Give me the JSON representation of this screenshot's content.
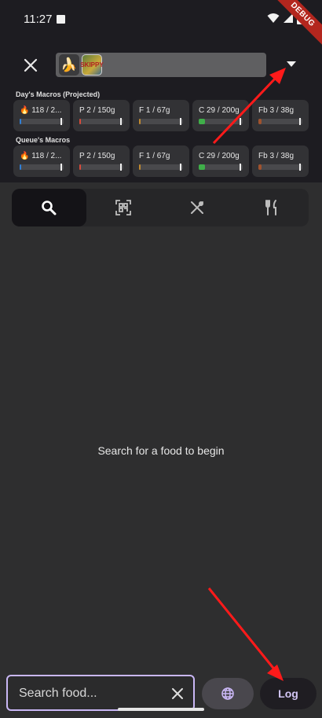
{
  "status_bar": {
    "time": "11:27",
    "debug_label": "DEBUG"
  },
  "queue": {
    "thumb_items": [
      "🍌",
      "SKIPPY"
    ]
  },
  "sections": {
    "day_label": "Day's Macros (Projected)",
    "queue_label": "Queue's Macros"
  },
  "day_macros": [
    {
      "label": "🔥 118 / 2...",
      "fill_fraction": 0.03,
      "color": "#2f7fd6"
    },
    {
      "label": "P 2 / 150g",
      "fill_fraction": 0.01,
      "color": "#d94a3a"
    },
    {
      "label": "F 1 / 67g",
      "fill_fraction": 0.01,
      "color": "#c08a30"
    },
    {
      "label": "C 29 / 200g",
      "fill_fraction": 0.14,
      "color": "#3fae49"
    },
    {
      "label": "Fb 3 / 38g",
      "fill_fraction": 0.08,
      "color": "#a0522d"
    }
  ],
  "queue_macros": [
    {
      "label": "🔥 118 / 2...",
      "fill_fraction": 0.03,
      "color": "#2f7fd6"
    },
    {
      "label": "P 2 / 150g",
      "fill_fraction": 0.01,
      "color": "#d94a3a"
    },
    {
      "label": "F 1 / 67g",
      "fill_fraction": 0.01,
      "color": "#c08a30"
    },
    {
      "label": "C 29 / 200g",
      "fill_fraction": 0.14,
      "color": "#3fae49"
    },
    {
      "label": "Fb 3 / 38g",
      "fill_fraction": 0.08,
      "color": "#a0522d"
    }
  ],
  "tabs": [
    {
      "icon": "search-icon",
      "active": true
    },
    {
      "icon": "qr-scan-icon",
      "active": false
    },
    {
      "icon": "cutlery-crossed-icon",
      "active": false
    },
    {
      "icon": "restaurant-icon",
      "active": false
    }
  ],
  "main": {
    "empty_message": "Search for a food to begin"
  },
  "bottom": {
    "search_placeholder": "Search food...",
    "log_label": "Log"
  },
  "colors": {
    "accent": "#c9b7f5",
    "annotation_arrow": "#ff1a1a"
  }
}
